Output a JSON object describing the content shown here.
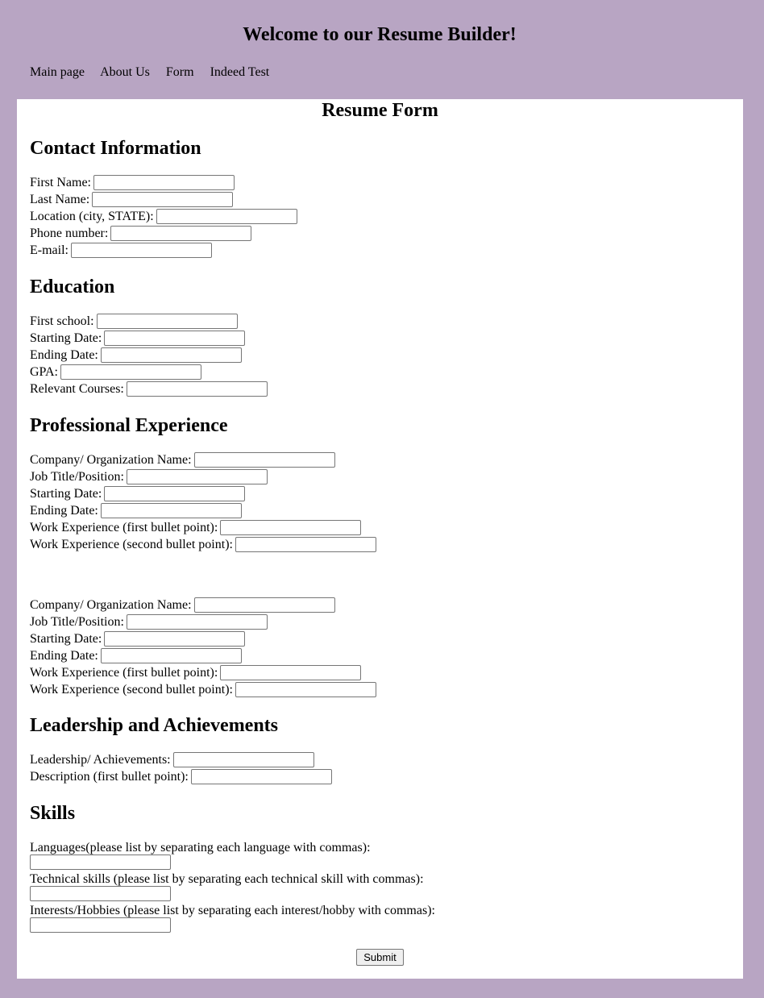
{
  "header": {
    "title": "Welcome to our Resume Builder!"
  },
  "nav": {
    "items": [
      "Main page",
      "About Us",
      "Form",
      "Indeed Test"
    ]
  },
  "form": {
    "title": "Resume Form",
    "contact": {
      "heading": "Contact Information",
      "fields": [
        "First Name:",
        "Last Name:",
        "Location (city, STATE):",
        "Phone number:",
        "E-mail:"
      ]
    },
    "education": {
      "heading": "Education",
      "fields": [
        "First school:",
        "Starting Date:",
        "Ending Date:",
        "GPA:",
        "Relevant Courses:"
      ]
    },
    "experience": {
      "heading": "Professional Experience",
      "job1": [
        "Company/ Organization Name:",
        "Job Title/Position:",
        "Starting Date:",
        "Ending Date:",
        "Work Experience (first bullet point):",
        "Work Experience (second bullet point):"
      ],
      "job2": [
        "Company/ Organization Name:",
        "Job Title/Position:",
        "Starting Date:",
        "Ending Date:",
        "Work Experience (first bullet point):",
        "Work Experience (second bullet point):"
      ]
    },
    "leadership": {
      "heading": "Leadership and Achievements",
      "fields": [
        "Leadership/ Achievements:",
        "Description (first bullet point):"
      ]
    },
    "skills": {
      "heading": "Skills",
      "fields": [
        "Languages(please list by separating each language with commas):",
        "Technical skills (please list by separating each technical skill with commas):",
        "Interests/Hobbies (please list by separating each interest/hobby with commas):"
      ]
    },
    "submit_label": "Submit"
  }
}
